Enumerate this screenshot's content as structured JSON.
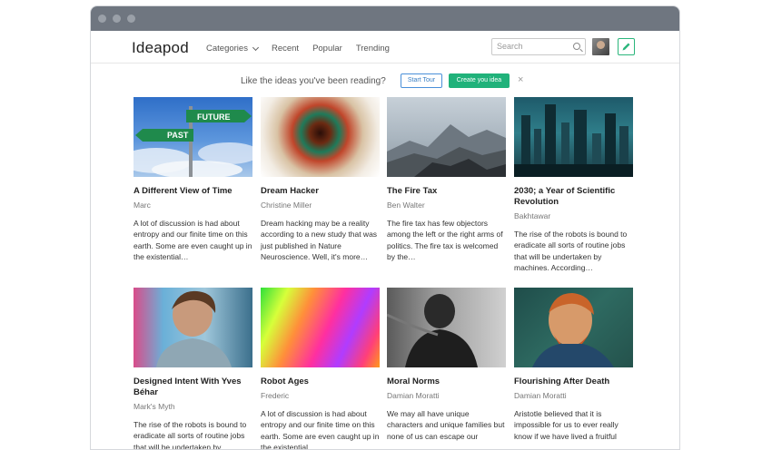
{
  "navbar": {
    "logo": "Ideapod",
    "nav": [
      "Categories",
      "Recent",
      "Popular",
      "Trending"
    ],
    "search_placeholder": "Search"
  },
  "banner": {
    "text": "Like the ideas you've been reading?",
    "tour_label": "Start Tour",
    "create_label": "Create you idea",
    "close": "×"
  },
  "cards": [
    {
      "title": "A Different View of Time",
      "author": "Marc",
      "excerpt": "A lot of discussion is had about entropy and our finite time on this earth. Some are even caught up in the existential…",
      "image": "past-future-signpost",
      "signs": [
        "PAST",
        "FUTURE"
      ]
    },
    {
      "title": "Dream Hacker",
      "author": "Christine Miller",
      "excerpt": "Dream hacking may be a reality according to a new study that was just published in Nature Neuroscience. Well, it's more…",
      "image": "colorful-tunnel"
    },
    {
      "title": "The Fire Tax",
      "author": "Ben Walter",
      "excerpt": "The fire tax has few objectors among the left or the right arms of politics. The fire tax is welcomed by the…",
      "image": "mountain-landscape"
    },
    {
      "title": "2030; a Year of Scientific Revolution",
      "author": "Bakhtawar",
      "excerpt": "The rise of the robots is bound to eradicate all sorts of routine jobs that will be undertaken by machines. According…",
      "image": "futuristic-city"
    },
    {
      "title": "Designed Intent With Yves Béhar",
      "author": "Mark's Myth",
      "excerpt": "The rise of the robots is bound to eradicate all sorts of routine jobs that will be undertaken by machines. According…",
      "image": "man-portrait"
    },
    {
      "title": "Robot Ages",
      "author": "Frederic",
      "excerpt": "A lot of discussion is had about entropy and our finite time on this earth. Some are even caught up in the existential…",
      "image": "color-gradient"
    },
    {
      "title": "Moral Norms",
      "author": "Damian Moratti",
      "excerpt": "We may all have unique characters and unique families but none of us can escape our",
      "image": "chained-man"
    },
    {
      "title": "Flourishing After Death",
      "author": "Damian Moratti",
      "excerpt": "Aristotle believed that it is impossible for us to ever really know if we have lived a fruitful",
      "image": "van-gogh-portrait"
    }
  ]
}
